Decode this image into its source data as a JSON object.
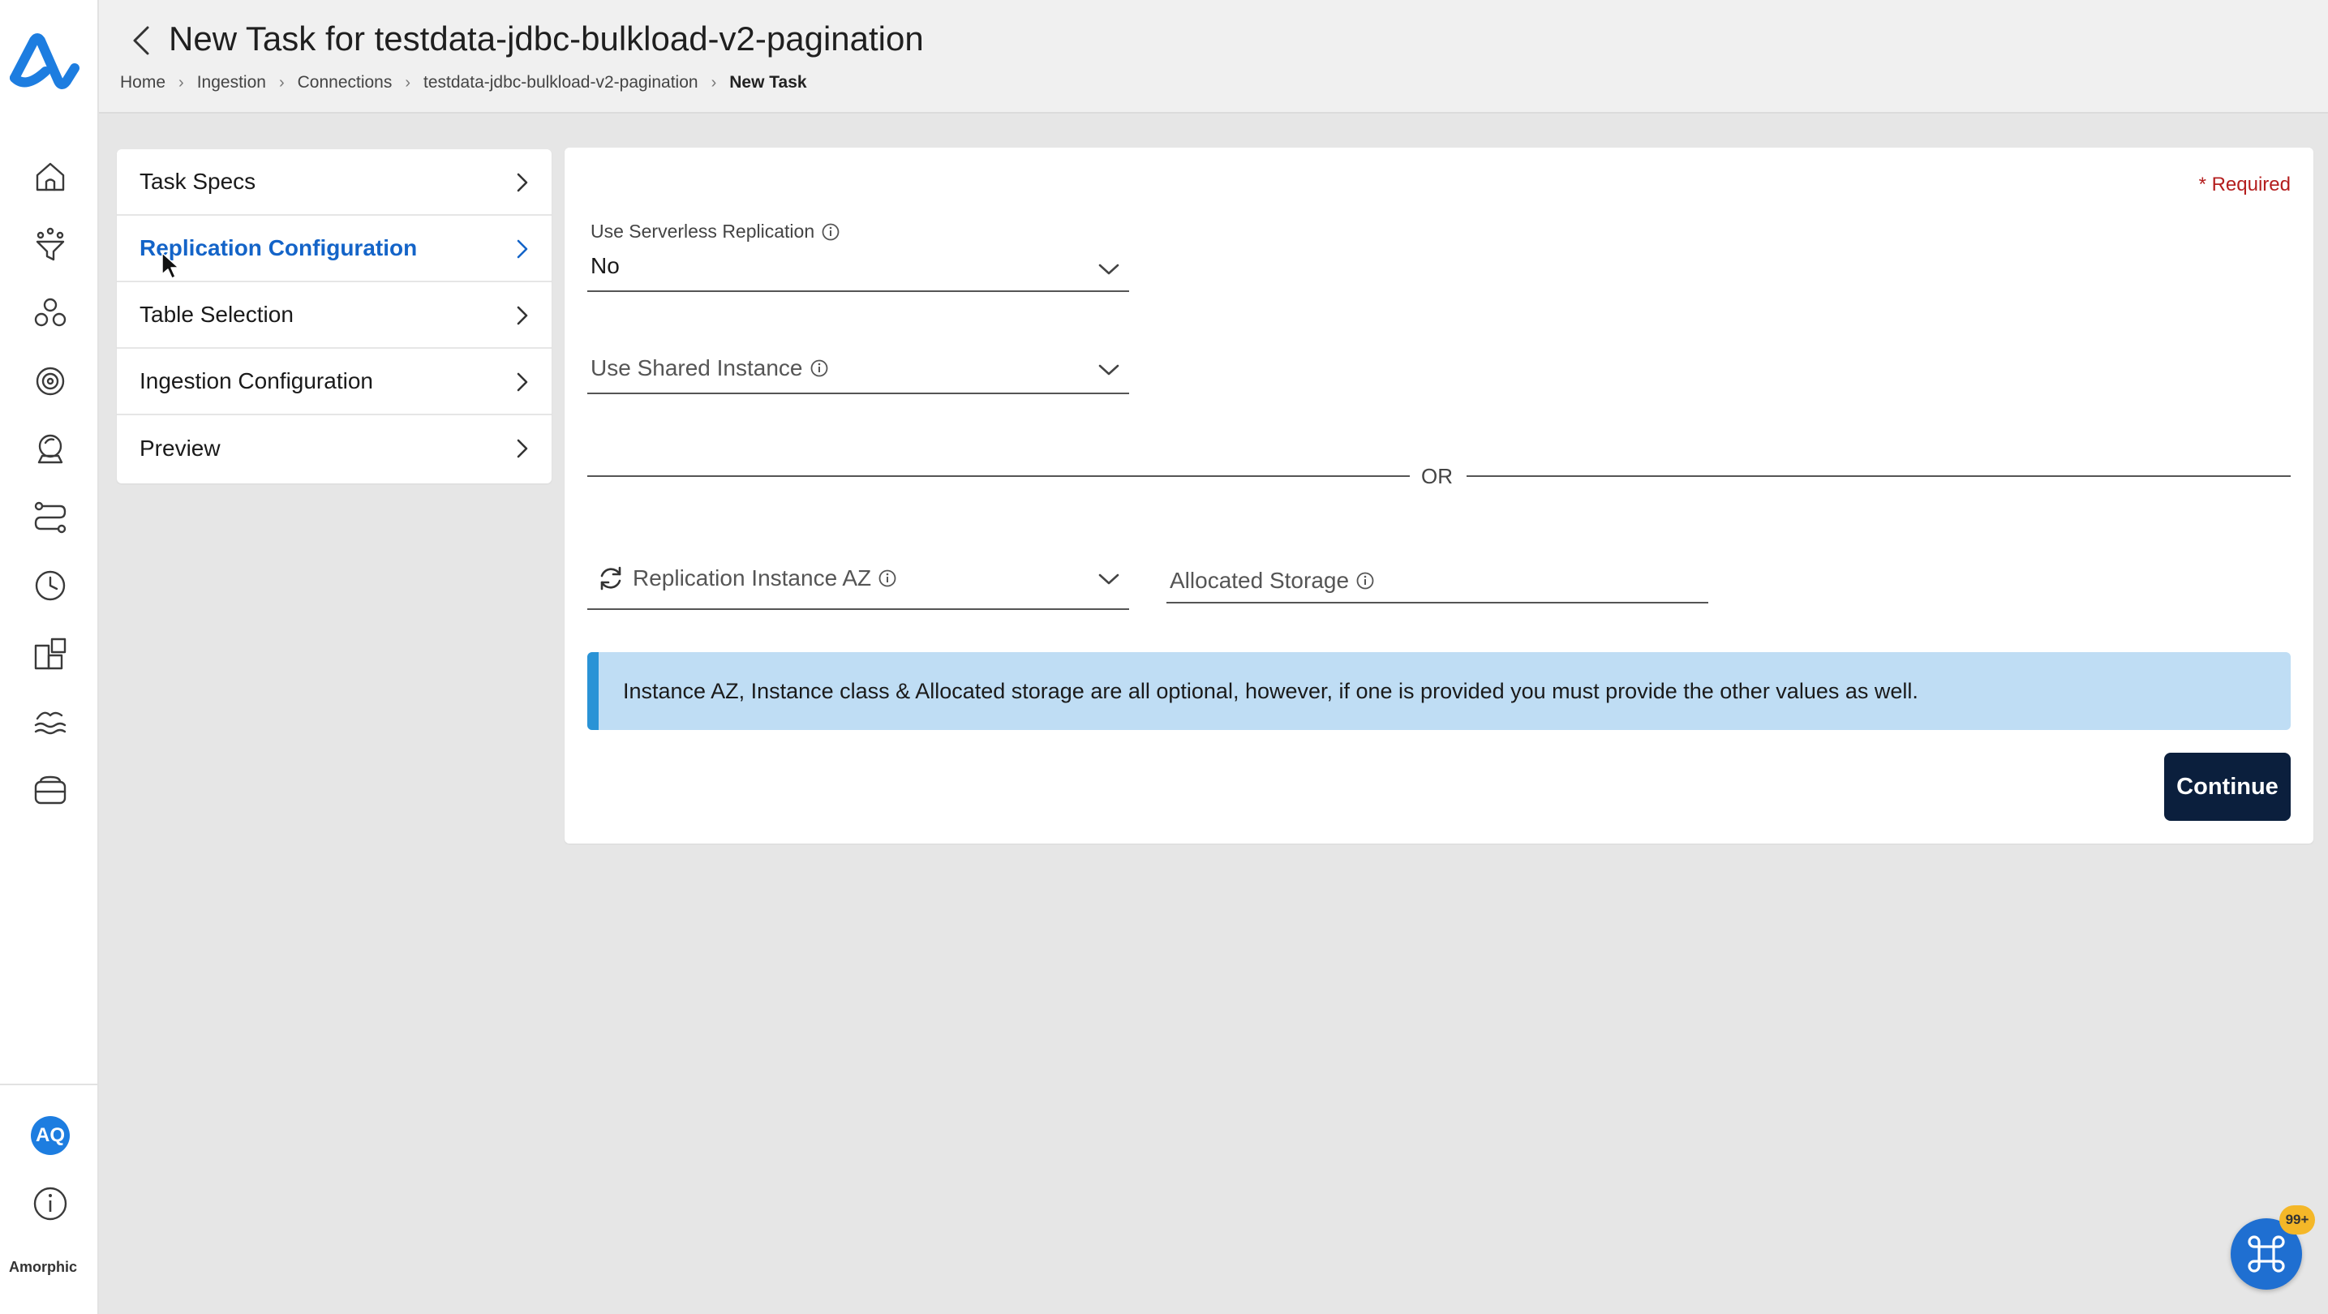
{
  "app": {
    "brand_name": "Amorphic",
    "brand_color": "#1d7de0",
    "user_initials": "AQ",
    "accent_color": "#1464c8"
  },
  "header": {
    "title": "New Task for testdata-jdbc-bulkload-v2-pagination",
    "breadcrumb": [
      "Home",
      "Ingestion",
      "Connections",
      "testdata-jdbc-bulkload-v2-pagination",
      "New Task"
    ]
  },
  "sidebar": {
    "icons": [
      "home-icon",
      "ingestion-funnel-icon",
      "datasets-icon",
      "settings-gear-icon",
      "insights-icon",
      "pipelines-icon",
      "schedules-clock-icon",
      "extensions-icon",
      "datalake-icon",
      "storage-icon"
    ]
  },
  "steps": [
    {
      "label": "Task Specs",
      "active": false
    },
    {
      "label": "Replication Configuration",
      "active": true
    },
    {
      "label": "Table Selection",
      "active": false
    },
    {
      "label": "Ingestion Configuration",
      "active": false
    },
    {
      "label": "Preview",
      "active": false
    }
  ],
  "form": {
    "required_note": "* Required",
    "serverless": {
      "label": "Use Serverless Replication",
      "value": "No"
    },
    "shared_instance": {
      "label": "Use Shared Instance",
      "value": ""
    },
    "or_text": "OR",
    "instance_az": {
      "label": "Replication Instance AZ",
      "value": ""
    },
    "allocated_storage": {
      "label": "Allocated Storage",
      "value": ""
    },
    "notice": "Instance AZ, Instance class & Allocated storage are all optional, however, if one is provided you must provide the other values as well.",
    "continue_label": "Continue"
  },
  "fab": {
    "badge": "99+"
  }
}
